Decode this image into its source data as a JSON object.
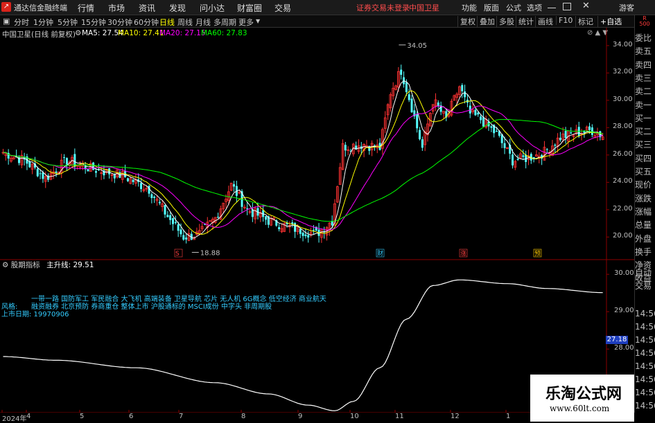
{
  "menubar": {
    "app_title": "通达信金融终端",
    "items": [
      "行情",
      "市场",
      "资讯",
      "发现",
      "问小达",
      "财富圈",
      "交易"
    ],
    "warning": "证券交易未登录",
    "stock_name": "中国卫星",
    "right_items": [
      "功能",
      "版面",
      "公式",
      "选项"
    ],
    "guest": "游客"
  },
  "toolbar": {
    "periods": [
      "分时",
      "1分钟",
      "5分钟",
      "15分钟",
      "30分钟",
      "60分钟",
      "日线",
      "周线",
      "月线",
      "多周期",
      "更多"
    ],
    "active": "日线",
    "right_items": [
      "复权",
      "叠加",
      "多股",
      "统计",
      "画线",
      "F10",
      "标记",
      "+自选"
    ]
  },
  "info": {
    "title": "中国卫星(日线 前复权)",
    "ma5": "MA5: 27.54",
    "ma10": "MA10: 27.41",
    "ma20": "MA20: 27.15",
    "ma60": "MA60: 27.83"
  },
  "indicator": {
    "name": "股期指标",
    "value": "主升线: 29.51",
    "lines": [
      "一带一路 国防军工 军民融合 大飞机 高端装备 卫星导航 芯片 无人机 6G概念 低空经济 商业航天",
      "融资融券 北京预防 券商重仓 整体上市 沪股通标的 MSCI成份 中字头 非周期股",
      "上市日期: 19970906"
    ],
    "style_label": "风格:",
    "last_value_box": "27.18"
  },
  "right_panel": {
    "items": [
      "委比",
      "卖五",
      "卖四",
      "卖三",
      "卖二",
      "卖一",
      "买一",
      "买二",
      "买三",
      "买四",
      "买五",
      "现价",
      "涨跌",
      "涨幅",
      "总量",
      "外盘",
      "换手",
      "净资",
      "收益"
    ],
    "lower_items": [
      "自动",
      "交易"
    ],
    "times": [
      "14:56",
      "14:56",
      "14:56",
      "14:56",
      "14:56",
      "14:56",
      "14:56",
      "14:56"
    ],
    "badge": "R 500"
  },
  "watermark": {
    "title": "乐淘公式网",
    "url": "www.60lt.com"
  },
  "chart_data": {
    "type": "line",
    "title": "中国卫星(日线 前复权)",
    "xlabel": "",
    "ylabel": "",
    "ylim": [
      18.5,
      34.5
    ],
    "yticks": [
      20.0,
      22.0,
      24.0,
      26.0,
      28.0,
      30.0,
      32.0,
      34.0
    ],
    "date_labels": [
      "2024年",
      "4",
      "5",
      "6",
      "7",
      "8",
      "9",
      "10",
      "11",
      "12",
      "1"
    ],
    "annotations": [
      {
        "label": "34.05",
        "value": 34.05
      },
      {
        "label": "18.88",
        "value": 18.88
      }
    ],
    "event_markers": [
      "S",
      "财",
      "涨",
      "预"
    ],
    "series": [
      {
        "name": "MA5",
        "color": "#ffffff"
      },
      {
        "name": "MA10",
        "color": "#ffff00"
      },
      {
        "name": "MA20",
        "color": "#ff00ff"
      },
      {
        "name": "MA60",
        "color": "#00ff00"
      }
    ],
    "indicator_chart": {
      "ylim": [
        26.3,
        30.3
      ],
      "yticks": [
        27.0,
        28.0,
        29.0,
        30.0
      ],
      "series": [
        {
          "name": "主升线",
          "color": "#ffffff"
        }
      ]
    }
  }
}
